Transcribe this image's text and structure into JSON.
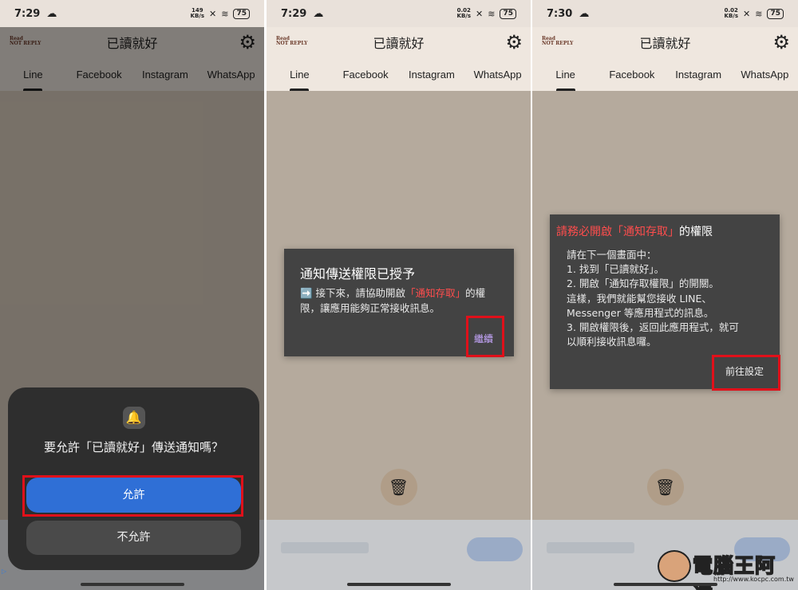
{
  "screens": [
    {
      "status": {
        "time": "7:29",
        "speed_top": "149",
        "speed_bottom": "KB/s",
        "battery": "75"
      },
      "app": {
        "title": "已讀就好",
        "logo_line1": "Read",
        "logo_line2": "NOT REPLY"
      },
      "tabs": [
        "Line",
        "Facebook",
        "Instagram",
        "WhatsApp"
      ],
      "sheet": {
        "question": "要允許「已讀就好」傳送通知嗎？",
        "allow": "允許",
        "deny": "不允許"
      }
    },
    {
      "status": {
        "time": "7:29",
        "speed_top": "0.02",
        "speed_bottom": "KB/s",
        "battery": "75"
      },
      "app": {
        "title": "已讀就好",
        "logo_line1": "Read",
        "logo_line2": "NOT REPLY"
      },
      "tabs": [
        "Line",
        "Facebook",
        "Instagram",
        "WhatsApp"
      ],
      "dialog": {
        "title": "通知傳送權限已授予",
        "arrow": "➡️",
        "body_pre": " 接下來，請協助開啟",
        "body_red": "「通知存取」",
        "body_post": "的權限，讓應用能夠正常接收訊息。",
        "button": "繼續"
      }
    },
    {
      "status": {
        "time": "7:30",
        "speed_top": "0.02",
        "speed_bottom": "KB/s",
        "battery": "75"
      },
      "app": {
        "title": "已讀就好",
        "logo_line1": "Read",
        "logo_line2": "NOT REPLY"
      },
      "tabs": [
        "Line",
        "Facebook",
        "Instagram",
        "WhatsApp"
      ],
      "dialog": {
        "title_red": "請務必開啟「通知存取」",
        "title_post": "的權限",
        "lines": [
          "請在下一個畫面中：",
          " 1. 找到「已讀就好」。",
          " 2. 開啟「通知存取權限」的開關。",
          " 這樣，我們就能幫您接收 LINE、",
          "Messenger 等應用程式的訊息。",
          " 3. 開啟權限後，返回此應用程式，就可",
          "以順利接收訊息囉。"
        ],
        "button": "前往設定"
      }
    }
  ],
  "watermark": {
    "text": "電腦王阿達",
    "url": "http://www.kocpc.com.tw"
  },
  "colors": {
    "highlight": "#e0101a",
    "allow": "#2f6fd6",
    "red_text": "#ff4d4d",
    "dialog": "#434343"
  },
  "icons": [
    "cloud-icon",
    "gear-icon",
    "bell-icon",
    "trash-icon",
    "wifi-icon",
    "battery-icon"
  ]
}
